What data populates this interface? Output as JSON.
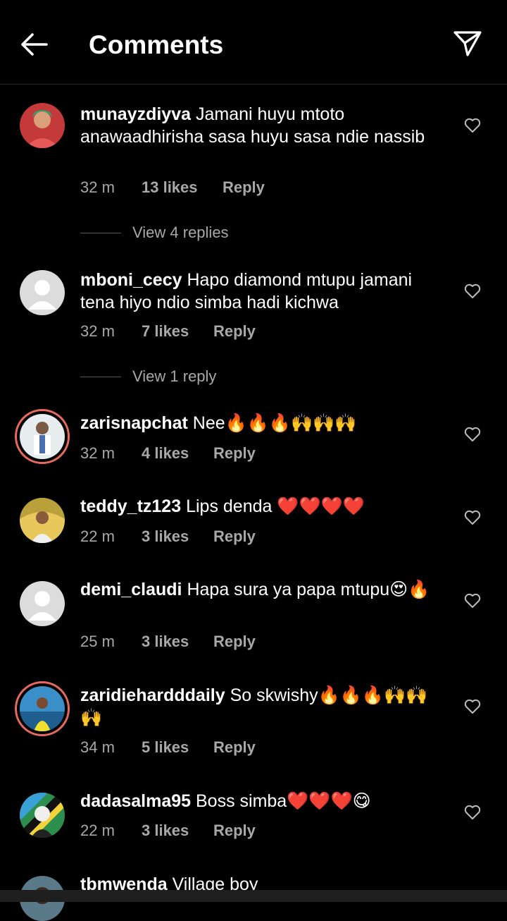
{
  "header": {
    "title": "Comments",
    "back_icon": "arrow-left-icon",
    "share_icon": "paper-plane-icon"
  },
  "comments": [
    {
      "username": "munayzdiyva",
      "text": "Jamani huyu mtoto anawaadhirisha sasa huyu sasa ndie nassib",
      "time": "32 m",
      "likes": "13 likes",
      "reply": "Reply",
      "view_replies": "View 4 replies"
    },
    {
      "username": "mboni_cecy",
      "text": "Hapo diamond mtupu jamani tena hiyo ndio simba hadi kichwa",
      "time": "32 m",
      "likes": "7 likes",
      "reply": "Reply",
      "view_replies": "View 1 reply"
    },
    {
      "username": "zarisnapchat",
      "text": "Nee🔥🔥🔥🙌🙌🙌",
      "time": "32 m",
      "likes": "4 likes",
      "reply": "Reply"
    },
    {
      "username": "teddy_tz123",
      "text": "Lips denda ❤️❤️❤️❤️",
      "time": "22 m",
      "likes": "3 likes",
      "reply": "Reply"
    },
    {
      "username": "demi_claudi",
      "text": "Hapa sura ya papa mtupu😍🔥",
      "time": "25 m",
      "likes": "3 likes",
      "reply": "Reply"
    },
    {
      "username": "zaridiehardddaily",
      "text": "So skwishy🔥🔥🔥🙌🙌🙌",
      "time": "34 m",
      "likes": "5 likes",
      "reply": "Reply"
    },
    {
      "username": "dadasalma95",
      "text": "Boss simba❤️❤️❤️😋",
      "time": "22 m",
      "likes": "3 likes",
      "reply": "Reply"
    },
    {
      "username": "tbmwenda",
      "text": "Village boy"
    }
  ]
}
